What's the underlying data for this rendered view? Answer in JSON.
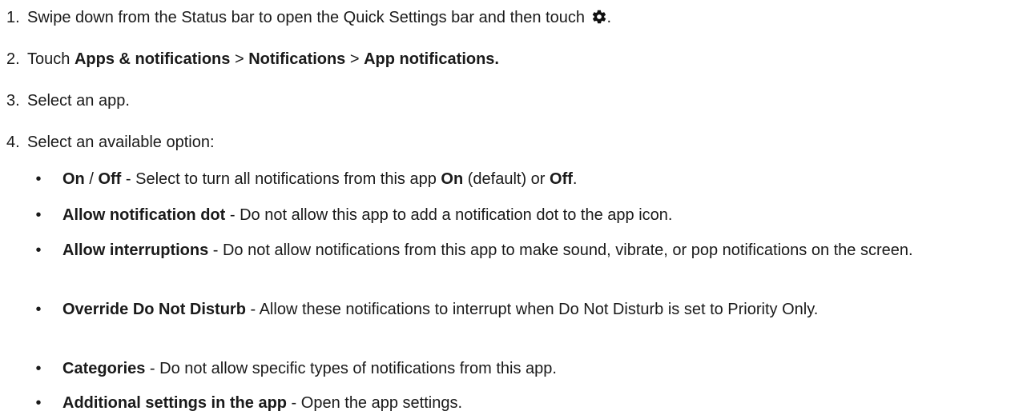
{
  "steps": [
    {
      "num": "1.",
      "text": "Swipe down from the Status bar to open the Quick Settings bar and then touch",
      "icon": "gear-icon",
      "suffix": "."
    },
    {
      "num": "2.",
      "prefix": "Touch ",
      "path": [
        "Apps & notifications",
        "Notifications",
        "App notifications."
      ],
      "sep": " > "
    },
    {
      "num": "3.",
      "text": "Select an app."
    },
    {
      "num": "4.",
      "text": "Select an available option:"
    }
  ],
  "options": [
    {
      "term_a": "On",
      "slash": " / ",
      "term_b": "Off",
      "desc_1": " - Select to turn all notifications from this app ",
      "on": "On",
      "desc_2": " (default) or ",
      "off": "Off",
      "end": "."
    },
    {
      "term": "Allow notification dot",
      "desc": " - Do not allow this app to add a notification dot to the app icon."
    },
    {
      "term": "Allow interruptions",
      "desc": " - Do not allow notifications from this app to make sound, vibrate, or pop notifications on the screen."
    },
    {
      "term": "Override Do Not Disturb",
      "desc": " - Allow these notifications to interrupt when Do Not Disturb is set to Priority Only."
    },
    {
      "term": "Categories",
      "desc": " - Do not allow specific types of notifications from this app."
    },
    {
      "term": "Additional settings in the app",
      "desc": " - Open the app settings."
    }
  ],
  "bullet_char": "•"
}
